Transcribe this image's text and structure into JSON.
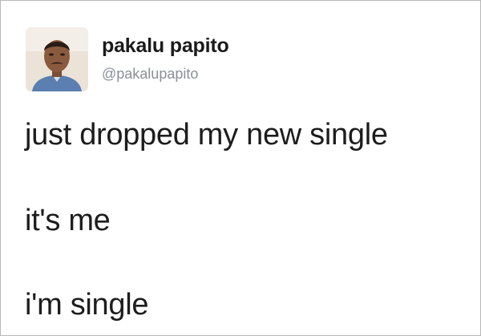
{
  "tweet": {
    "author": {
      "display_name": "pakalu papito",
      "handle": "@pakalupapito",
      "avatar_icon": "profile-photo"
    },
    "lines": [
      "just dropped my new single",
      "it's me",
      "i'm single"
    ]
  },
  "colors": {
    "text": "#1d1d1d",
    "handle": "#8a9097",
    "border": "#b8b8b8",
    "background": "#ffffff"
  }
}
